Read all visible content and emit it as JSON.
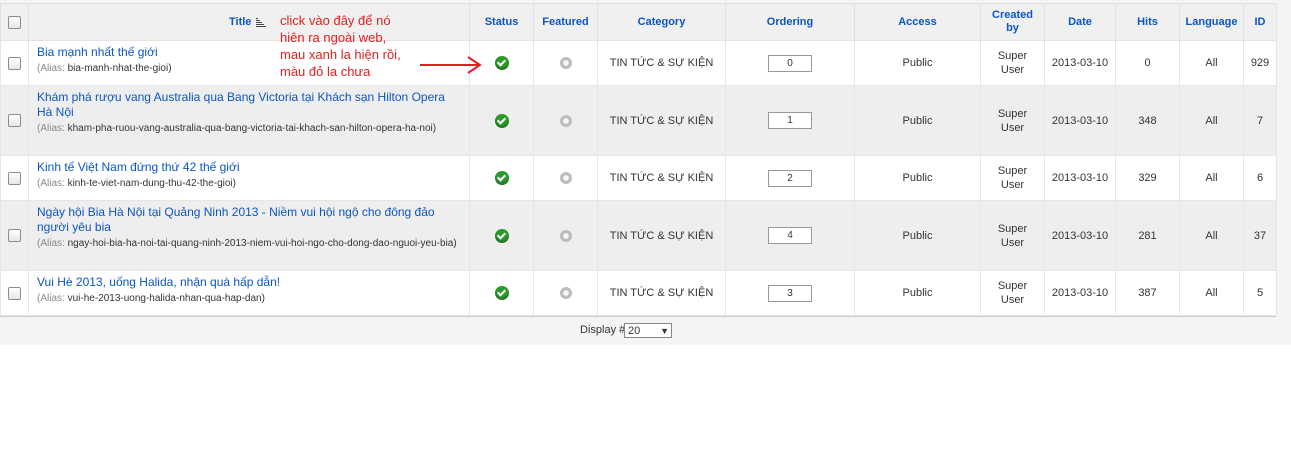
{
  "headers": {
    "title": "Title",
    "status": "Status",
    "featured": "Featured",
    "category": "Category",
    "ordering": "Ordering",
    "access": "Access",
    "created_by": "Created by",
    "date": "Date",
    "hits": "Hits",
    "language": "Language",
    "id": "ID"
  },
  "alias_label": "(Alias:",
  "rows": [
    {
      "title": "Bia mạnh nhất thế giới",
      "alias": "bia-manh-nhat-the-gioi",
      "status": "published",
      "featured": false,
      "category": "TIN TỨC & SỰ KIỆN",
      "ordering": "0",
      "access": "Public",
      "created_by": "Super User",
      "date": "2013-03-10",
      "hits": "0",
      "language": "All",
      "id": "929"
    },
    {
      "title": "Khám phá rượu vang Australia qua Bang Victoria tại Khách sạn Hilton Opera Hà Nội",
      "alias": "kham-pha-ruou-vang-australia-qua-bang-victoria-tai-khach-san-hilton-opera-ha-noi",
      "status": "published",
      "featured": false,
      "category": "TIN TỨC & SỰ KIỆN",
      "ordering": "1",
      "access": "Public",
      "created_by": "Super User",
      "date": "2013-03-10",
      "hits": "348",
      "language": "All",
      "id": "7"
    },
    {
      "title": "Kinh tế Việt Nam đứng thứ 42 thế giới",
      "alias": "kinh-te-viet-nam-dung-thu-42-the-gioi",
      "status": "published",
      "featured": false,
      "category": "TIN TỨC & SỰ KIỆN",
      "ordering": "2",
      "access": "Public",
      "created_by": "Super User",
      "date": "2013-03-10",
      "hits": "329",
      "language": "All",
      "id": "6"
    },
    {
      "title": "Ngày hội Bia Hà Nội tại Quảng Ninh 2013 - Niềm vui hội ngộ cho đông đảo người yêu bia",
      "alias": "ngay-hoi-bia-ha-noi-tai-quang-ninh-2013-niem-vui-hoi-ngo-cho-dong-dao-nguoi-yeu-bia",
      "status": "published",
      "featured": false,
      "category": "TIN TỨC & SỰ KIỆN",
      "ordering": "4",
      "access": "Public",
      "created_by": "Super User",
      "date": "2013-03-10",
      "hits": "281",
      "language": "All",
      "id": "37"
    },
    {
      "title": "Vui Hè 2013, uống Halida, nhận quà hấp dẫn!",
      "alias": "vui-he-2013-uong-halida-nhan-qua-hap-dan",
      "status": "published",
      "featured": false,
      "category": "TIN TỨC & SỰ KIỆN",
      "ordering": "3",
      "access": "Public",
      "created_by": "Super User",
      "date": "2013-03-10",
      "hits": "387",
      "language": "All",
      "id": "5"
    }
  ],
  "footer": {
    "display_label": "Display #",
    "display_value": "20"
  },
  "annotation": {
    "line1": "click vào đây để nó",
    "line2": "hiên ra ngoài web,",
    "line3": "mau xanh la hiện rồi,",
    "line4": "màu đỏ la chưa"
  },
  "colors": {
    "link": "#0b55c4",
    "published_green": "#2a9a2a",
    "annotation_red": "#e02020"
  }
}
